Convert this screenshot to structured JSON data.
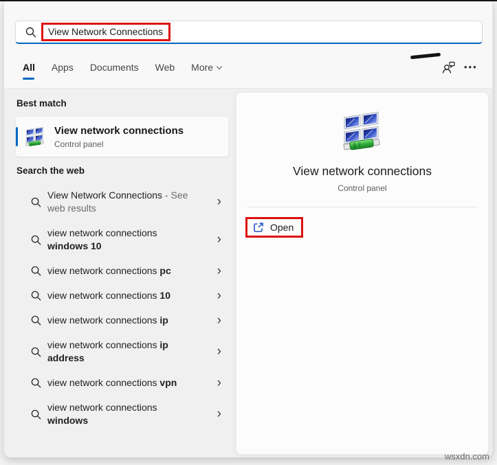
{
  "search": {
    "value": "View Network Connections"
  },
  "tabs": {
    "items": [
      {
        "label": "All"
      },
      {
        "label": "Apps"
      },
      {
        "label": "Documents"
      },
      {
        "label": "Web"
      },
      {
        "label": "More"
      }
    ]
  },
  "topbar": {
    "ellipsis": "•••"
  },
  "best_match": {
    "heading": "Best match",
    "item": {
      "title": "View network connections",
      "subtitle": "Control panel",
      "icon": "network-connections-icon"
    }
  },
  "search_web": {
    "heading": "Search the web",
    "items": [
      {
        "lines": [
          [
            {
              "t": "View Network Connections",
              "s": "n"
            },
            {
              "t": " - See",
              "s": "g"
            }
          ],
          [
            {
              "t": "web results",
              "s": "g"
            }
          ]
        ]
      },
      {
        "lines": [
          [
            {
              "t": "view network connections",
              "s": "n"
            }
          ],
          [
            {
              "t": "windows 10",
              "s": "b"
            }
          ]
        ]
      },
      {
        "lines": [
          [
            {
              "t": "view network connections ",
              "s": "n"
            },
            {
              "t": "pc",
              "s": "b"
            }
          ]
        ]
      },
      {
        "lines": [
          [
            {
              "t": "view network connections ",
              "s": "n"
            },
            {
              "t": "10",
              "s": "b"
            }
          ]
        ]
      },
      {
        "lines": [
          [
            {
              "t": "view network connections ",
              "s": "n"
            },
            {
              "t": "ip",
              "s": "b"
            }
          ]
        ]
      },
      {
        "lines": [
          [
            {
              "t": "view network connections ",
              "s": "n"
            },
            {
              "t": "ip",
              "s": "b"
            }
          ],
          [
            {
              "t": "address",
              "s": "b"
            }
          ]
        ]
      },
      {
        "lines": [
          [
            {
              "t": "view network connections ",
              "s": "n"
            },
            {
              "t": "vpn",
              "s": "b"
            }
          ]
        ]
      },
      {
        "lines": [
          [
            {
              "t": "view network connections",
              "s": "n"
            }
          ],
          [
            {
              "t": "windows",
              "s": "b"
            }
          ]
        ]
      }
    ],
    "chevron_glyph": "›"
  },
  "preview": {
    "title": "View network connections",
    "subtitle": "Control panel",
    "open_label": "Open",
    "icon": "network-connections-icon"
  },
  "watermark": "wsxdn.com",
  "colors": {
    "accent": "#0067c0",
    "annotation": "#dd1010"
  }
}
